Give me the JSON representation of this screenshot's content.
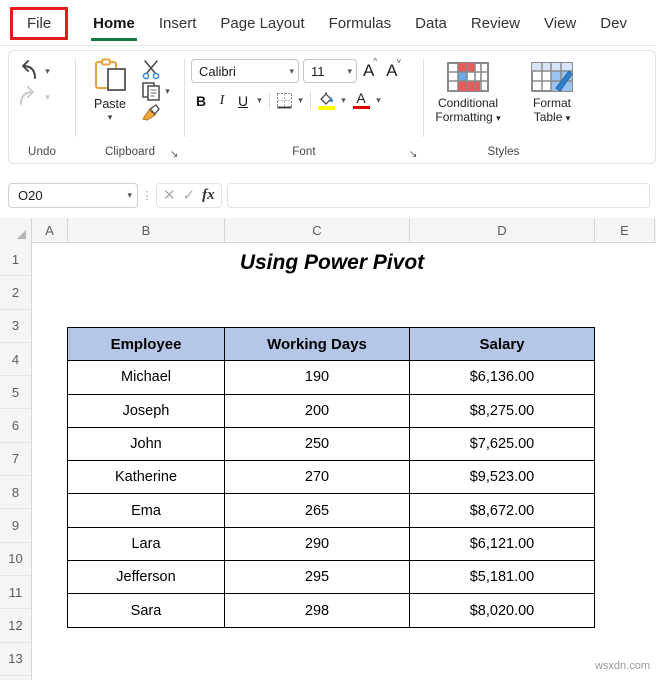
{
  "ribbon": {
    "tabs": [
      {
        "label": "File",
        "active": false,
        "boxed": true
      },
      {
        "label": "Home",
        "active": true,
        "boxed": false
      },
      {
        "label": "Insert",
        "active": false,
        "boxed": false
      },
      {
        "label": "Page Layout",
        "active": false,
        "boxed": false
      },
      {
        "label": "Formulas",
        "active": false,
        "boxed": false
      },
      {
        "label": "Data",
        "active": false,
        "boxed": false
      },
      {
        "label": "Review",
        "active": false,
        "boxed": false
      },
      {
        "label": "View",
        "active": false,
        "boxed": false
      },
      {
        "label": "Dev",
        "active": false,
        "boxed": false
      }
    ],
    "groups": {
      "undo": {
        "label": "Undo",
        "undo_icon": "undo-arrow-icon",
        "redo_icon": "redo-arrow-icon"
      },
      "clipboard": {
        "label": "Clipboard",
        "paste_label": "Paste",
        "cut_icon": "scissors-icon",
        "copy_icon": "copy-icon",
        "format_painter_icon": "paintbrush-icon"
      },
      "font": {
        "label": "Font",
        "font_name": "Calibri",
        "font_size": "11",
        "grow_label": "A",
        "shrink_label": "A",
        "bold_label": "B",
        "italic_label": "I",
        "underline_label": "U",
        "borders_icon": "borders-icon",
        "fill_color_icon": "fill-color-icon",
        "font_color_icon": "font-color-icon",
        "highlight_color": "#ffff00",
        "font_color": "#e00000"
      },
      "styles": {
        "label": "Styles",
        "conditional_formatting": "Conditional\nFormatting",
        "conditional_formatting_line1": "Conditional",
        "conditional_formatting_line2": "Formatting",
        "format_as_table_line1": "Format",
        "format_as_table_line2": "Table"
      }
    }
  },
  "formula_bar": {
    "name_box": "O20",
    "cancel_icon": "cancel-x-icon",
    "enter_icon": "enter-check-icon",
    "fx_label": "fx",
    "formula_value": ""
  },
  "grid": {
    "columns": [
      "A",
      "B",
      "C",
      "D",
      "E"
    ],
    "rows": [
      "1",
      "2",
      "3",
      "4",
      "5",
      "6",
      "7",
      "8",
      "9",
      "10",
      "11",
      "12",
      "13"
    ],
    "title": "Using Power Pivot",
    "table": {
      "headers": [
        "Employee",
        "Working Days",
        "Salary"
      ],
      "rows": [
        [
          "Michael",
          "190",
          "$6,136.00"
        ],
        [
          "Joseph",
          "200",
          "$8,275.00"
        ],
        [
          "John",
          "250",
          "$7,625.00"
        ],
        [
          "Katherine",
          "270",
          "$9,523.00"
        ],
        [
          "Ema",
          "265",
          "$8,672.00"
        ],
        [
          "Lara",
          "290",
          "$6,121.00"
        ],
        [
          "Jefferson",
          "295",
          "$5,181.00"
        ],
        [
          "Sara",
          "298",
          "$8,020.00"
        ]
      ],
      "header_fill": "#b4c7e7"
    }
  },
  "watermark": "wsxdn.com",
  "colors": {
    "accent_green": "#107c41",
    "highlight_red": "#e8191b",
    "header_blue": "#b4c7e7"
  }
}
